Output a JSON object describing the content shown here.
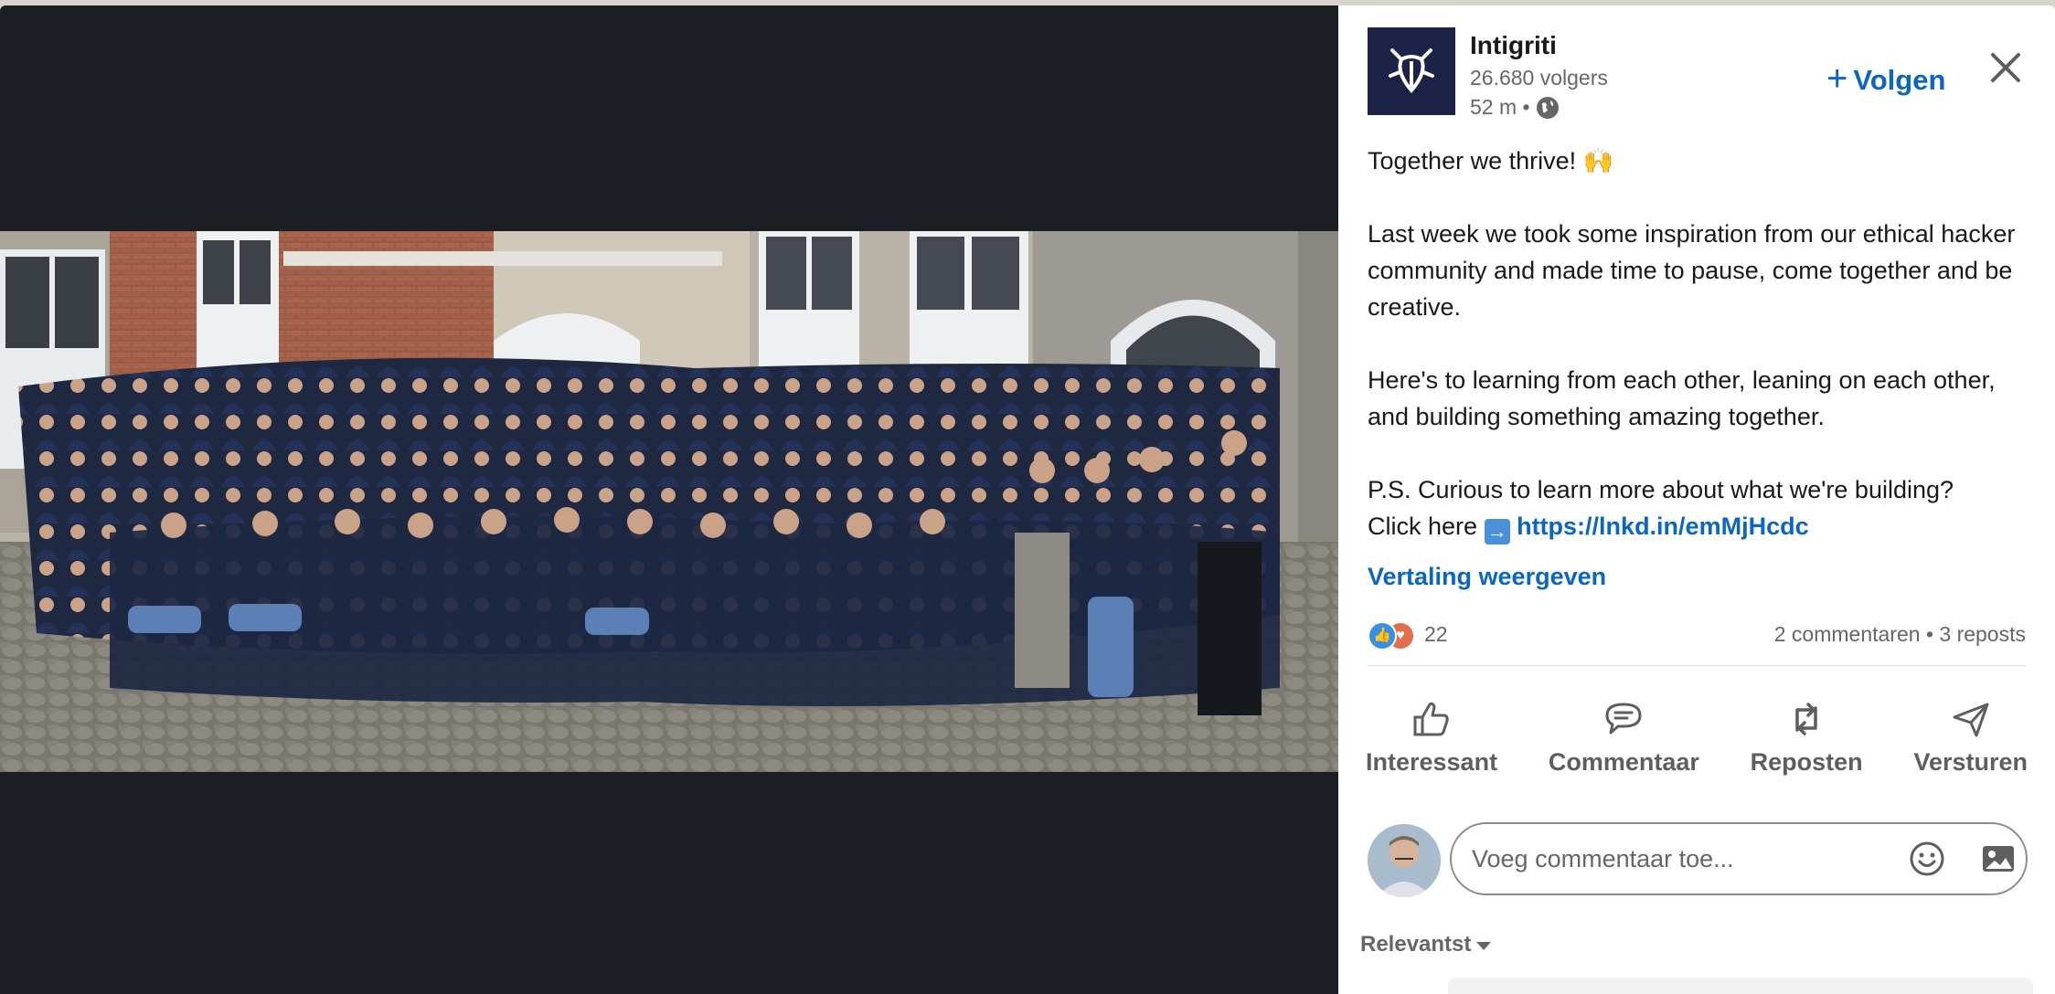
{
  "post": {
    "company": "Intigriti",
    "followers": "26.680 volgers",
    "time": "52 m •",
    "follow_label": "Volgen",
    "paragraph1": "Together we thrive! 🙌",
    "paragraph2": "Last week we took some inspiration from our ethical hacker community and made time to pause, come together and be creative.",
    "paragraph3": "Here's to learning from each other, leaning on each other, and building something amazing together.",
    "paragraph4_line1": "P.S. Curious to learn more about what we're building?",
    "paragraph4_prefix": "Click here",
    "link": "https://lnkd.in/emMjHcdc",
    "translate_label": "Vertaling weergeven"
  },
  "social": {
    "reaction_count": "22",
    "comments_reposts": "2 commentaren • 3 reposts"
  },
  "actions": {
    "like": "Interessant",
    "comment": "Commentaar",
    "repost": "Reposten",
    "send": "Versturen"
  },
  "comment_box": {
    "placeholder": "Voeg commentaar toe..."
  },
  "sort": {
    "label": "Relevantst"
  },
  "icons": {
    "logo": "intigriti-bug-logo",
    "privacy": "globe-icon",
    "close": "close-icon",
    "emoji": "emoji-icon",
    "image": "image-icon"
  },
  "colors": {
    "accent": "#0a66c2",
    "media_background": "#1b1f23",
    "logo_background": "#1c2346"
  }
}
